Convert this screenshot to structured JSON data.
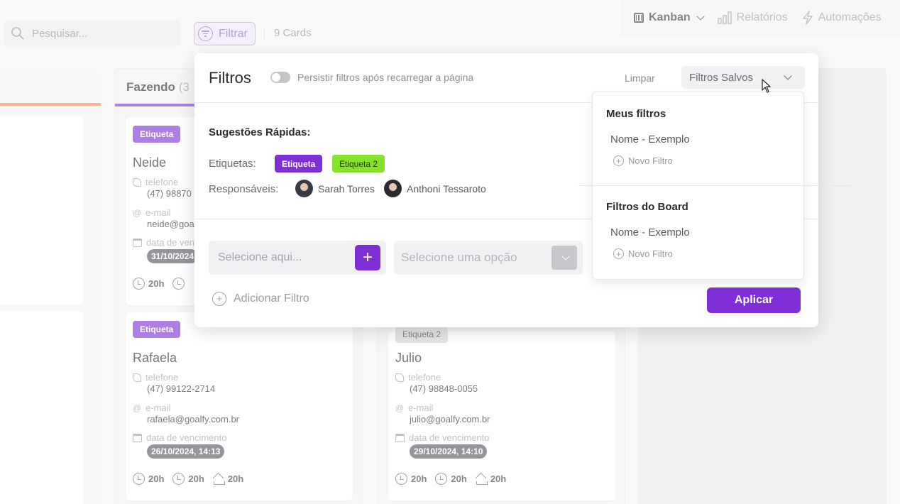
{
  "topbar": {
    "search_placeholder": "Pesquisar...",
    "filter_label": "Filtrar",
    "cards_count": "9 Cards",
    "view_label": "Kanban",
    "reports_label": "Relatórios",
    "automations_label": "Automações"
  },
  "board": {
    "column_fazendo_name": "Fazendo",
    "column_fazendo_count": "(3",
    "cards": [
      {
        "tag": "Etiqueta",
        "name": "Neide",
        "phone_label": "telefone",
        "phone": "(47) 98870",
        "email_label": "e-mail",
        "email": "neide@goa",
        "due_label": "data de venc",
        "due": "31/10/2024",
        "hours": [
          "20h",
          ""
        ]
      },
      {
        "tag": "Etiqueta",
        "name": "Rafaela",
        "phone_label": "telefone",
        "phone": "(47) 99122-2714",
        "email_label": "e-mail",
        "email": "rafaela@goalfy.com.br",
        "due_label": "data de vencimento",
        "due": "26/10/2024, 14:13",
        "hours": [
          "20h",
          "20h",
          "20h"
        ]
      },
      {
        "tag": "Etiqueta 2",
        "name": "Julio",
        "phone_label": "telefone",
        "phone": "(47) 98848-0055",
        "email_label": "e-mail",
        "email": "julio@goalfy.com.br",
        "due_label": "data de vencimento",
        "due": "29/10/2024, 14:10",
        "hours": [
          "20h",
          "20h",
          "20h"
        ]
      }
    ]
  },
  "panel": {
    "title": "Filtros",
    "persist_label": "Persistir filtros após recarregar a página",
    "clear_label": "Limpar",
    "saved_filters_label": "Filtros Salvos",
    "suggestions_title": "Sugestões Rápidas:",
    "tags_label": "Etiquetas:",
    "tags": [
      "Etiqueta",
      "Etiqueta 2"
    ],
    "responsibles_label": "Responsáveis:",
    "responsibles": [
      "Sarah Torres",
      "Anthoni Tessaroto"
    ],
    "select_placeholder": "Selecione aqui...",
    "option_placeholder": "Selecione uma opção",
    "add_filter_label": "Adicionar Filtro",
    "apply_label": "Aplicar"
  },
  "saved_dropdown": {
    "my_filters_title": "Meus filtros",
    "my_filters_item": "Nome - Exemplo",
    "my_new_filter": "Novo Filtro",
    "board_filters_title": "Filtros do Board",
    "board_filters_item": "Nome - Exemplo",
    "board_new_filter": "Novo Filtro"
  },
  "colors": {
    "accent": "#7e2fd6",
    "tag_green": "#86e22a",
    "column_bar_orange": "#f2894b"
  }
}
